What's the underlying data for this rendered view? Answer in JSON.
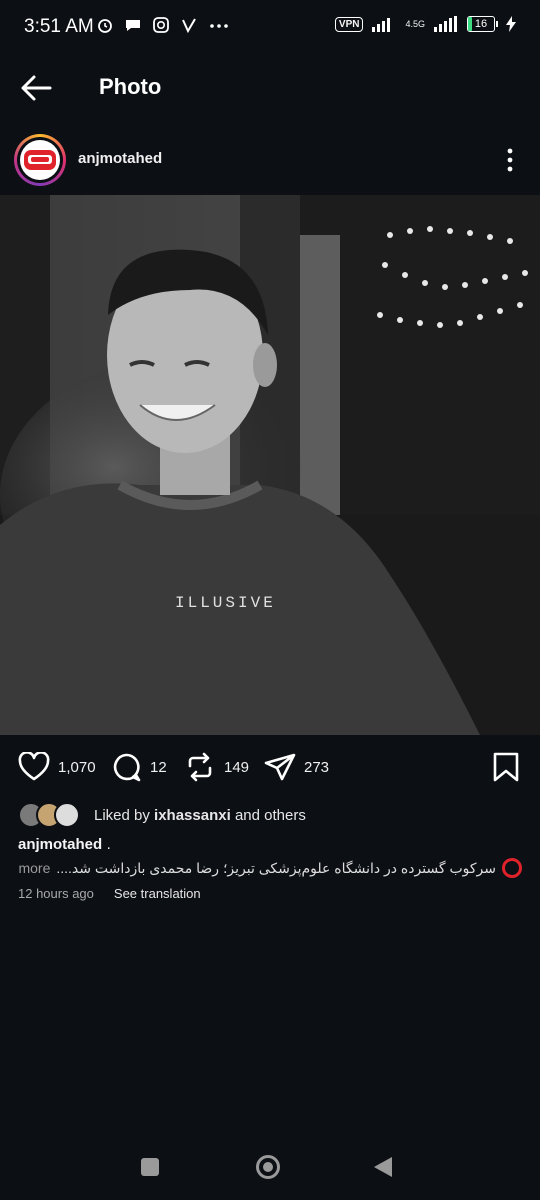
{
  "status_bar": {
    "time": "3:51 AM",
    "left_icons": [
      "alarm-icon",
      "chat-bubble-icon",
      "instagram-icon",
      "v-icon",
      "more-dots"
    ],
    "right": {
      "vpn": "VPN",
      "network": "4.5G",
      "battery": "16",
      "battery_level": 0.16
    }
  },
  "header": {
    "title": "Photo"
  },
  "post": {
    "author": "anjmotahed",
    "actions": {
      "likes": "1,070",
      "comments": "12",
      "reposts": "149",
      "shares": "273"
    },
    "liked_by": {
      "prefix": "Liked by",
      "user": "ixhassanxi",
      "suffix": "and others"
    },
    "caption": {
      "user": "anjmotahed",
      "dot": ".",
      "text": "سرکوب گسترده در دانشگاه علوم‌پزشکی تبریز؛ رضا محمدی بازداشت شد....",
      "more": "more"
    },
    "time_ago": "12 hours ago",
    "see_translation": "See translation",
    "photo_text": "ILLUSIVE"
  },
  "colors": {
    "background": "#0c0f14",
    "accent_red": "#e0222a",
    "battery_green": "#3ddc84"
  }
}
